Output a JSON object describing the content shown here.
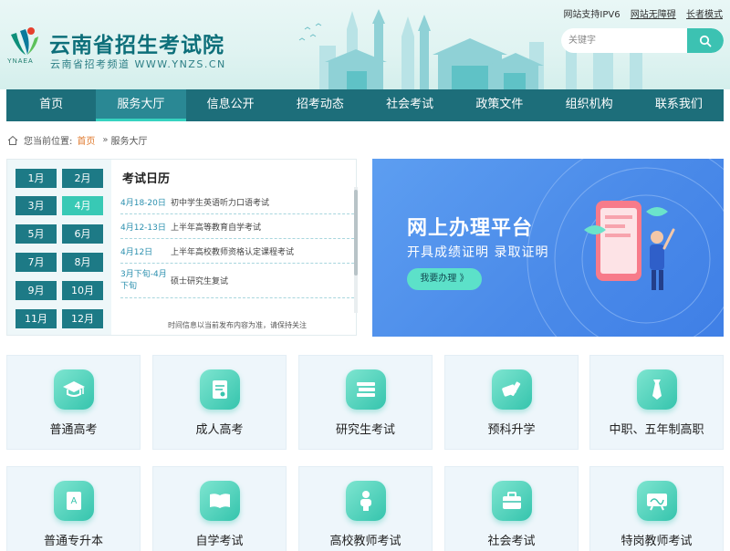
{
  "header": {
    "logo_text": "YNAEA",
    "site_title": "云南省招生考试院",
    "site_subtitle": "云南省招考频道 WWW.YNZS.CN",
    "top_links": [
      "网站支持IPV6",
      "网站无障碍",
      "长者模式"
    ],
    "search": {
      "placeholder": "关键字"
    }
  },
  "nav": {
    "items": [
      "首页",
      "服务大厅",
      "信息公开",
      "招考动态",
      "社会考试",
      "政策文件",
      "组织机构",
      "联系我们"
    ],
    "active_index": 1
  },
  "breadcrumb": {
    "prefix": "您当前位置:",
    "home": "首页",
    "separator": "»",
    "current": "服务大厅"
  },
  "calendar": {
    "title": "考试日历",
    "months": [
      "1月",
      "2月",
      "3月",
      "4月",
      "5月",
      "6月",
      "7月",
      "8月",
      "9月",
      "10月",
      "11月",
      "12月"
    ],
    "active_month": "4月",
    "events": [
      {
        "date": "4月18-20日",
        "name": "初中学生英语听力口语考试"
      },
      {
        "date": "4月12-13日",
        "name": "上半年高等教育自学考试"
      },
      {
        "date": "4月12日",
        "name": "上半年高校教师资格认定课程考试"
      },
      {
        "date": "3月下旬-4月下旬",
        "name": "硕士研究生复试"
      }
    ],
    "note": "时间信息以当前发布内容为准，请保持关注"
  },
  "banner": {
    "title": "网上办理平台",
    "subtitle": "开具成绩证明 录取证明",
    "button": "我要办理 》"
  },
  "services": [
    {
      "label": "普通高考",
      "icon": "graduation-cap-icon"
    },
    {
      "label": "成人高考",
      "icon": "certificate-icon"
    },
    {
      "label": "研究生考试",
      "icon": "books-icon"
    },
    {
      "label": "预科升学",
      "icon": "pencil-ruler-icon"
    },
    {
      "label": "中职、五年制高职",
      "icon": "necktie-icon"
    },
    {
      "label": "普通专升本",
      "icon": "document-icon"
    },
    {
      "label": "自学考试",
      "icon": "open-book-icon"
    },
    {
      "label": "高校教师考试",
      "icon": "teacher-icon"
    },
    {
      "label": "社会考试",
      "icon": "briefcase-icon"
    },
    {
      "label": "特岗教师考试",
      "icon": "blackboard-icon"
    }
  ],
  "colors": {
    "nav_bg": "#1d6e7a",
    "accent": "#38c9b5",
    "banner_bg": "#4b8be9",
    "breadcrumb_active": "#e07a2e"
  }
}
